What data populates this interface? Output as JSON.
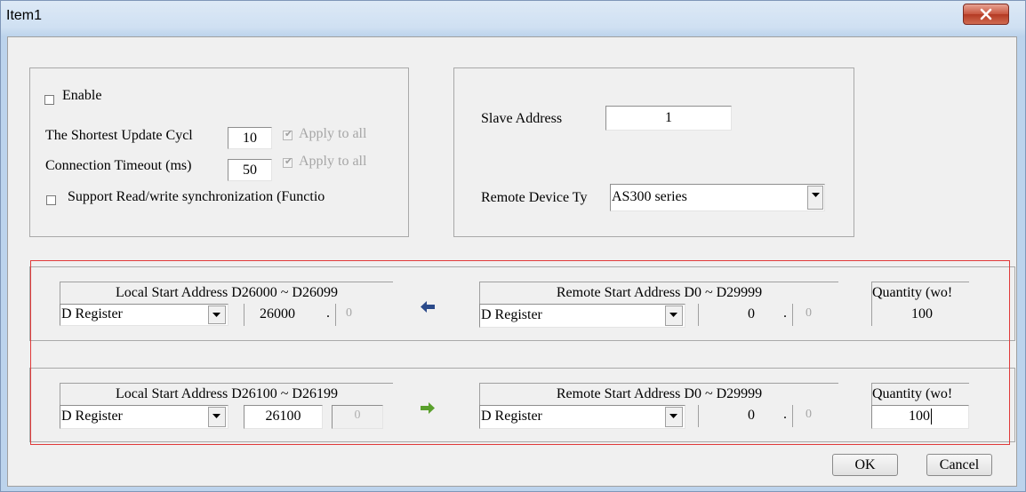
{
  "window": {
    "title": "Item1"
  },
  "general": {
    "enable_label": "Enable",
    "update_cycle_label": "The Shortest Update Cycl",
    "update_cycle_value": "10",
    "apply_all_1": "Apply to all",
    "timeout_label": "Connection Timeout (ms)",
    "timeout_value": "50",
    "apply_all_2": "Apply to all",
    "sync_label": "Support Read/write synchronization (Functio"
  },
  "device": {
    "slave_label": "Slave Address",
    "slave_value": "1",
    "remote_type_label": "Remote Device Ty",
    "remote_type_value": "AS300 series"
  },
  "mappings": [
    {
      "local_header": "Local Start Address D26000 ~ D26099",
      "local_type": "D Register",
      "local_start": "26000",
      "local_dot": ".",
      "local_bit": "0",
      "direction": "read",
      "remote_header": "Remote Start Address D0 ~ D29999",
      "remote_type": "D Register",
      "remote_start": "0",
      "remote_dot": ".",
      "remote_bit": "0",
      "qty_header": "Quantity (wo!",
      "qty_value": "100"
    },
    {
      "local_header": "Local Start Address D26100 ~ D26199",
      "local_type": "D Register",
      "local_start": "26100",
      "local_bit": "0",
      "direction": "write",
      "remote_header": "Remote Start Address D0 ~ D29999",
      "remote_type": "D Register",
      "remote_start": "0",
      "remote_dot": ".",
      "remote_bit": "0",
      "qty_header": "Quantity (wo!",
      "qty_value": "100"
    }
  ],
  "buttons": {
    "ok": "OK",
    "cancel": "Cancel"
  },
  "colors": {
    "read_arrow": "#2b4a8a",
    "write_arrow": "#5aa02c",
    "highlight": "#e03a3a"
  },
  "icons": {
    "close": "close-icon",
    "left_arrow": "arrow-left-icon",
    "right_arrow": "arrow-right-icon",
    "dropdown": "chevron-down-icon"
  }
}
